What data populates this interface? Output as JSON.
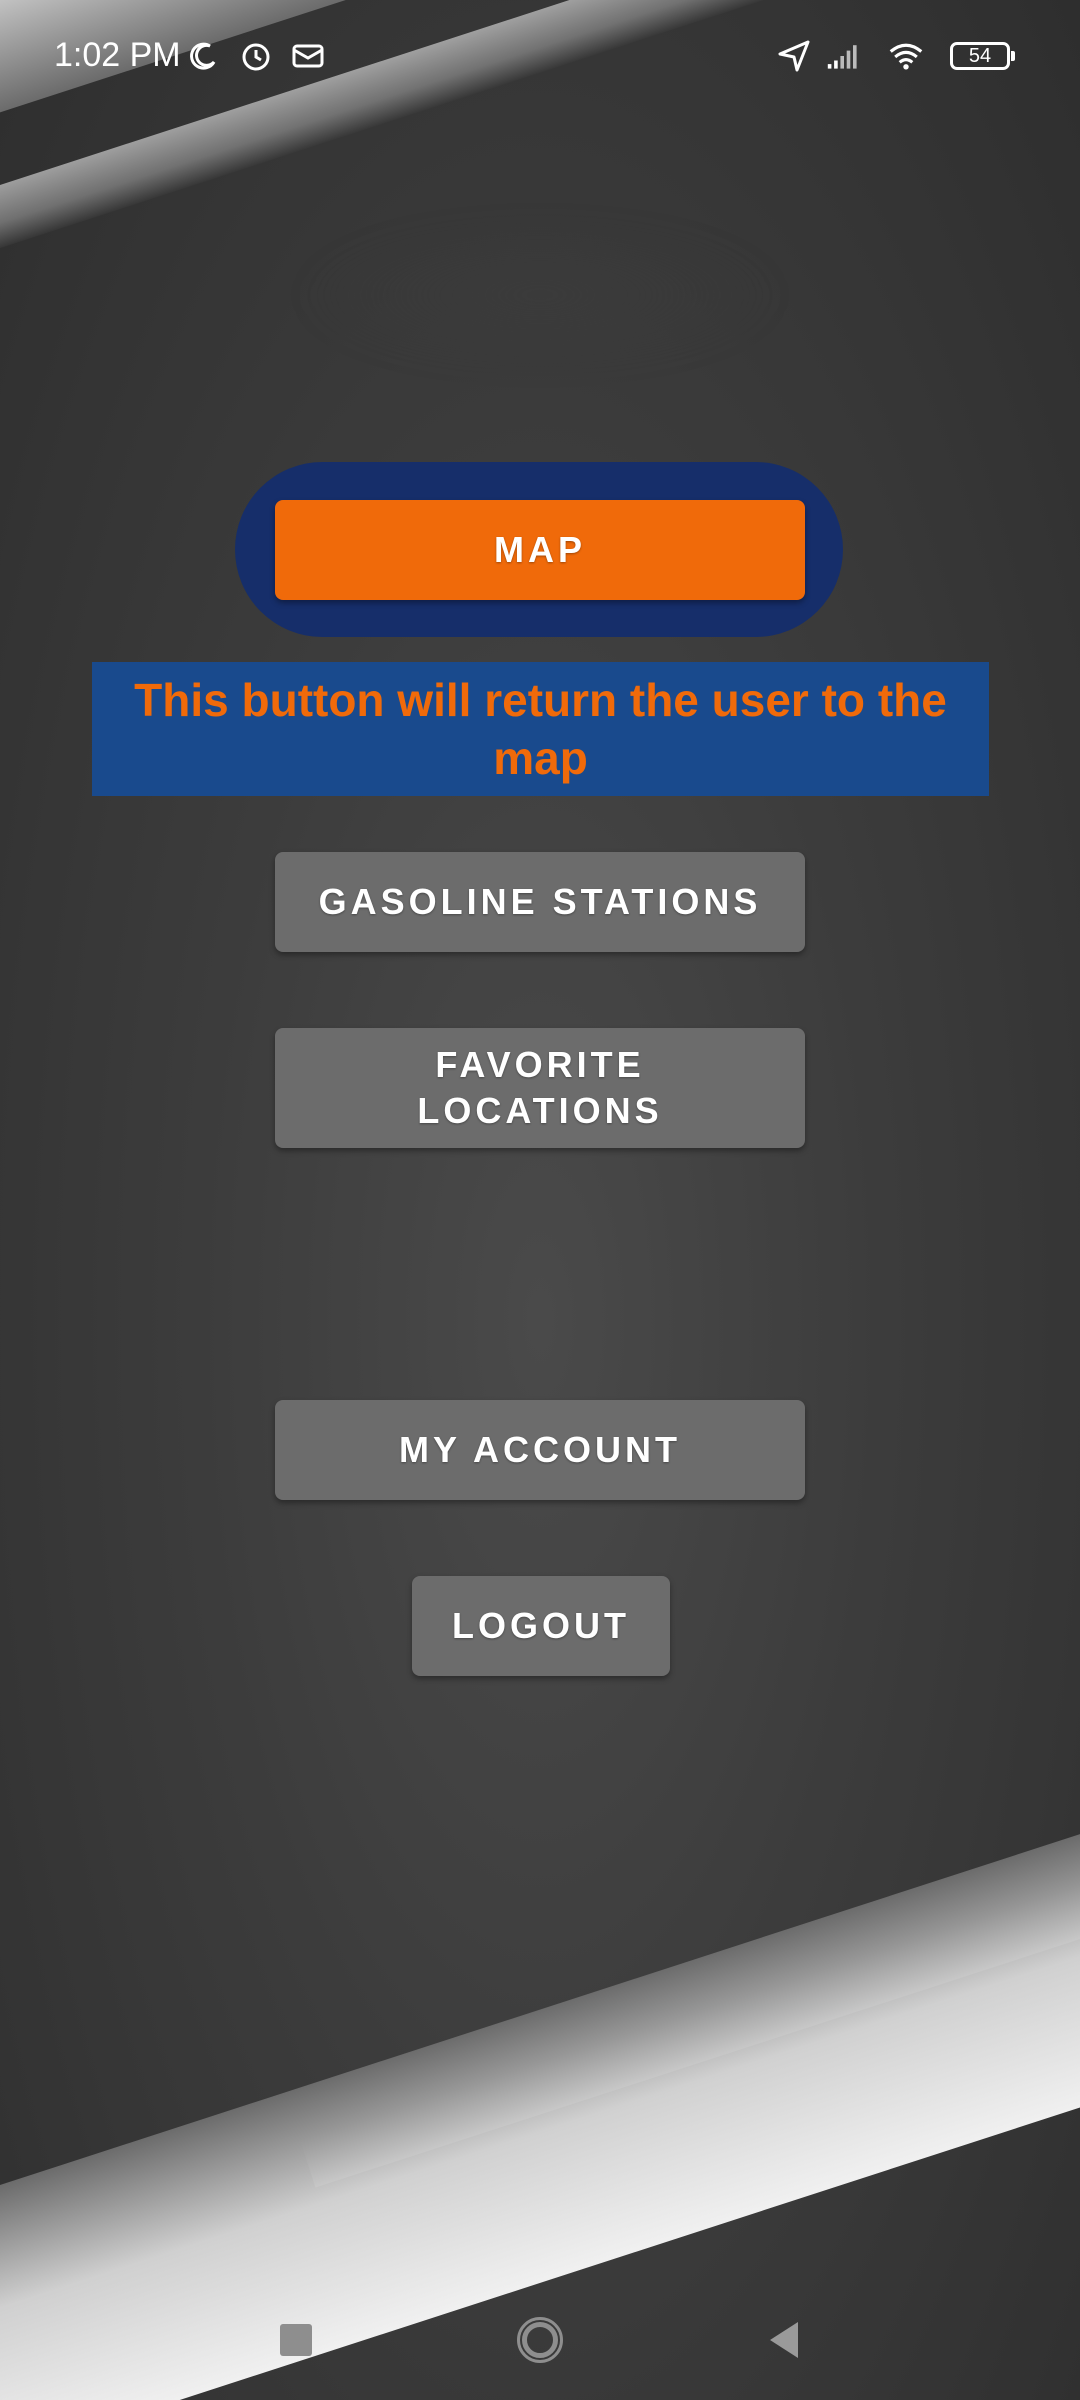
{
  "status_bar": {
    "time": "1:02 PM",
    "battery_level": "54",
    "left_icons": [
      "moon-icon",
      "alarm-icon",
      "mail-icon"
    ],
    "right_icons": [
      "location-arrow-icon",
      "signal-icon",
      "wifi-icon",
      "battery-icon"
    ]
  },
  "menu": {
    "map_label": "MAP",
    "gasoline_label": "GASOLINE STATIONS",
    "favorites_label": "FAVORITE LOCATIONS",
    "account_label": "MY ACCOUNT",
    "logout_label": "LOGOUT"
  },
  "tooltip": {
    "text": "This button will return the user to the map"
  },
  "colors": {
    "accent_orange": "#f06a0a",
    "tooltip_blue": "#194a8d",
    "highlight_navy": "#162e6a",
    "button_gray": "#6c6c6c"
  },
  "nav_bar": {
    "icons": [
      "recents-square-icon",
      "home-circle-icon",
      "back-triangle-icon"
    ]
  }
}
